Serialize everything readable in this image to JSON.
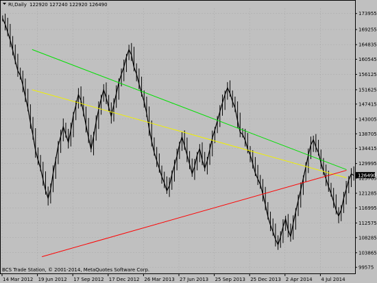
{
  "header": {
    "symbol_period": "RI,Daily",
    "ohlc": "122920 127240 122920 126490"
  },
  "copyright": "BCS Trade Station, © 2001-2014, MetaQuotes Software Corp.",
  "colors": {
    "background": "#c0c0c0",
    "candles": "#000000",
    "line_green": "#00e000",
    "line_yellow": "#f0f000",
    "line_red": "#ff0000",
    "grid": "#a8a8a8"
  },
  "chart_data": {
    "type": "line",
    "title": "",
    "ylim": [
      98000,
      175500
    ],
    "y_ticks": [
      173955,
      169255,
      164835,
      160545,
      156125,
      151625,
      147415,
      143005,
      138705,
      134415,
      129995,
      125705,
      121285,
      116995,
      112575,
      108285,
      103865,
      99575
    ],
    "x_labels": [
      "14 Mar 2012",
      "19 Jun 2012",
      "17 Sep 2012",
      "17 Dec 2012",
      "26 Mar 2013",
      "27 Jun 2013",
      "25 Sep 2013",
      "25 Dec 2013",
      "2 Apr 2014",
      "4 Jul 2014"
    ],
    "last_price": "126490",
    "grid": true,
    "series": [
      {
        "values": [
          172500,
          170800,
          168500,
          166200,
          163200,
          160000,
          157200,
          155800,
          153000,
          149500,
          146200,
          142000,
          138200,
          133800,
          131100,
          128600,
          125300,
          122100,
          119800,
          122500,
          127300,
          131000,
          135200,
          138000,
          140800,
          138500,
          136200,
          139800,
          144200,
          147000,
          150200,
          148500,
          145000,
          141200,
          137500,
          134200,
          137900,
          142200,
          145800,
          149000,
          151600,
          149200,
          146500,
          143800,
          147200,
          150500,
          153800,
          156200,
          158300,
          161200,
          163400,
          161800,
          158200,
          156200,
          153300,
          150500,
          148200,
          144800,
          140200,
          136500,
          133200,
          130800,
          128500,
          126200,
          124300,
          122000,
          123500,
          126800,
          129500,
          132200,
          135500,
          137800,
          135200,
          132500,
          129800,
          127000,
          129200,
          132500,
          134300,
          131000,
          128600,
          130800,
          134200,
          137500,
          139800,
          142500,
          145200,
          147800,
          150200,
          152200,
          150500,
          148200,
          146300,
          142500,
          139200,
          138500,
          136800,
          134200,
          132500,
          130000,
          127200,
          125500,
          123800,
          121000,
          117800,
          114500,
          112000,
          110000,
          107800,
          106200,
          108500,
          111500,
          113800,
          110500,
          108600,
          112400,
          115800,
          119200,
          122300,
          125600,
          129000,
          132500,
          135500,
          137000,
          134800,
          133200,
          130200,
          127800,
          125500,
          123200,
          121200,
          118800,
          116300,
          114600,
          116400,
          119800,
          122500,
          125200,
          127000,
          126490
        ]
      },
      {
        "name": "",
        "kind": "trendline",
        "points": [
          [
            3,
            163400
          ],
          [
            35,
            128200
          ]
        ]
      },
      {
        "name": "",
        "kind": "trendline",
        "points": [
          [
            3,
            151600
          ],
          [
            35,
            125800
          ]
        ]
      },
      {
        "name": "",
        "kind": "trendline",
        "points": [
          [
            4,
            102700
          ],
          [
            35,
            128000
          ]
        ]
      }
    ]
  }
}
